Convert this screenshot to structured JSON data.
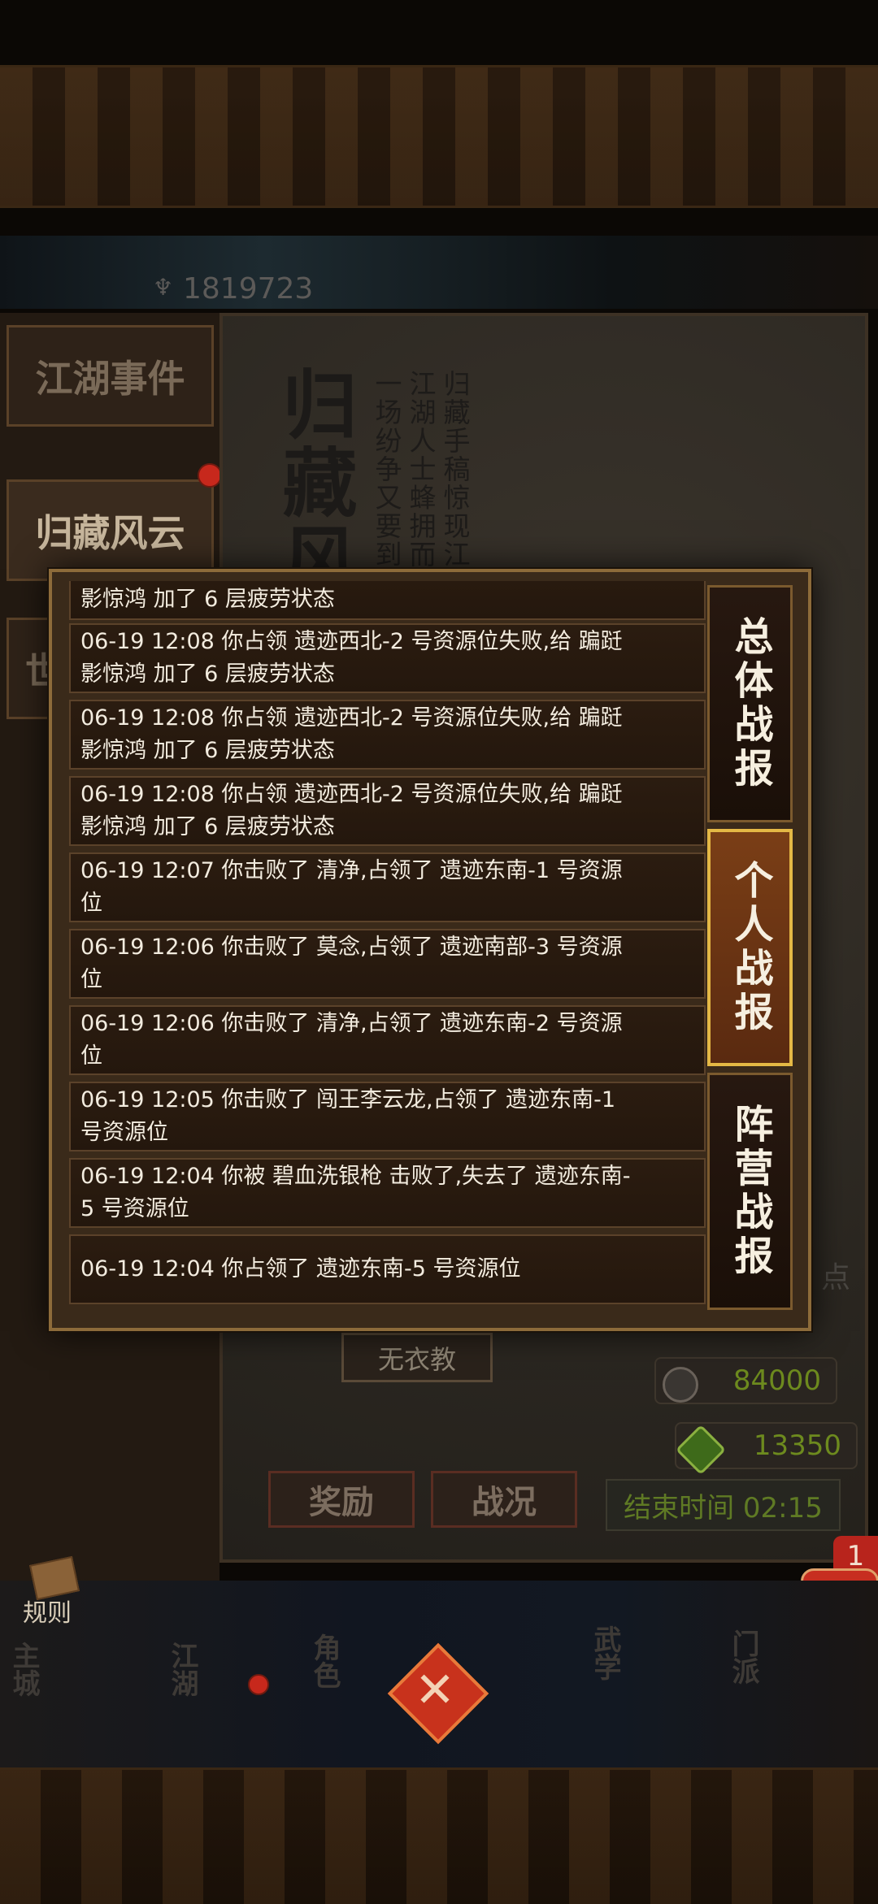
{
  "header": {
    "power_value": "1819723"
  },
  "side_tabs": [
    {
      "label": "江湖事件"
    },
    {
      "label": "归藏风云"
    },
    {
      "label": "世"
    }
  ],
  "parchment": {
    "title": "归藏风",
    "columns": [
      "归藏手稿惊现江",
      "江湖人士蜂拥而",
      "一场纷争又要到"
    ]
  },
  "reports": [
    {
      "line1": "影惊鸿 加了 6 层疲劳状态",
      "line2": ""
    },
    {
      "line1": "06-19 12:08  你占领 遗迹西北-2 号资源位失败,给 蹁跹",
      "line2": "影惊鸿 加了 6 层疲劳状态"
    },
    {
      "line1": "06-19 12:08  你占领 遗迹西北-2 号资源位失败,给 蹁跹",
      "line2": "影惊鸿 加了 6 层疲劳状态"
    },
    {
      "line1": "06-19 12:08  你占领 遗迹西北-2 号资源位失败,给 蹁跹",
      "line2": "影惊鸿 加了 6 层疲劳状态"
    },
    {
      "line1": "06-19 12:07  你击败了 清净,占领了 遗迹东南-1 号资源",
      "line2": "位"
    },
    {
      "line1": "06-19 12:06  你击败了 莫念,占领了 遗迹南部-3 号资源",
      "line2": "位"
    },
    {
      "line1": "06-19 12:06  你击败了 清净,占领了 遗迹东南-2 号资源",
      "line2": "位"
    },
    {
      "line1": "06-19 12:05  你击败了 闯王李云龙,占领了 遗迹东南-1",
      "line2": "号资源位"
    },
    {
      "line1": "06-19 12:04  你被 碧血洗银枪 击败了,失去了 遗迹东南-",
      "line2": "5 号资源位"
    },
    {
      "line1": "06-19 12:04  你占领了 遗迹东南-5 号资源位",
      "line2": ""
    }
  ],
  "report_tabs": [
    {
      "label": "总体战报",
      "selected": false
    },
    {
      "label": "个人战报",
      "selected": true
    },
    {
      "label": "阵营战报",
      "selected": false
    }
  ],
  "faction": {
    "name": "无衣教"
  },
  "resources": [
    {
      "icon": "coin-icon",
      "value": "84000",
      "color": "#6d8a1e"
    },
    {
      "icon": "jade-icon",
      "value": "13350",
      "color": "#6d8a1e"
    }
  ],
  "side_label": "点",
  "buttons": {
    "reward": "奖励",
    "battle_status": "战况"
  },
  "end_time": "结束时间 02:15",
  "rules_label": "规则",
  "chat_badge": "1",
  "nav": [
    {
      "label": "主城"
    },
    {
      "label": "江湖"
    },
    {
      "label": "角色"
    },
    {
      "label": "武学"
    },
    {
      "label": "门派"
    }
  ],
  "colors": {
    "accent_gold": "#e4b845",
    "selected_tab": "#7a3e16",
    "resource_green": "#6d8a1e"
  }
}
